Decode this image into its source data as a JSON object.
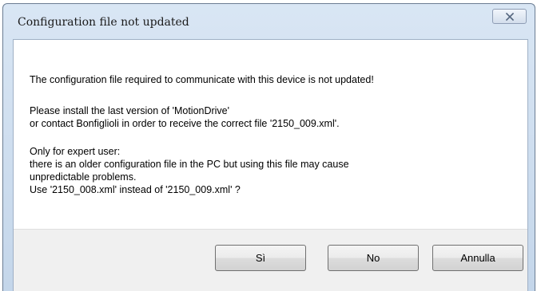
{
  "dialog": {
    "title": "Configuration file not updated",
    "close_icon": "close-icon",
    "message": {
      "line1": "The configuration file required to communicate with this device is not updated!",
      "line2": "Please install the last version of 'MotionDrive'",
      "line3": "or contact Bonfiglioli in order to receive the correct file '2150_009.xml'.",
      "line4": "Only for expert user:",
      "line5": "there is an older configuration file in the PC but using this file may cause",
      "line6": "unpredictable problems.",
      "line7": "Use '2150_008.xml' instead of '2150_009.xml' ?"
    },
    "buttons": {
      "yes_label": "Sì",
      "no_label": "No",
      "cancel_label": "Annulla"
    }
  }
}
